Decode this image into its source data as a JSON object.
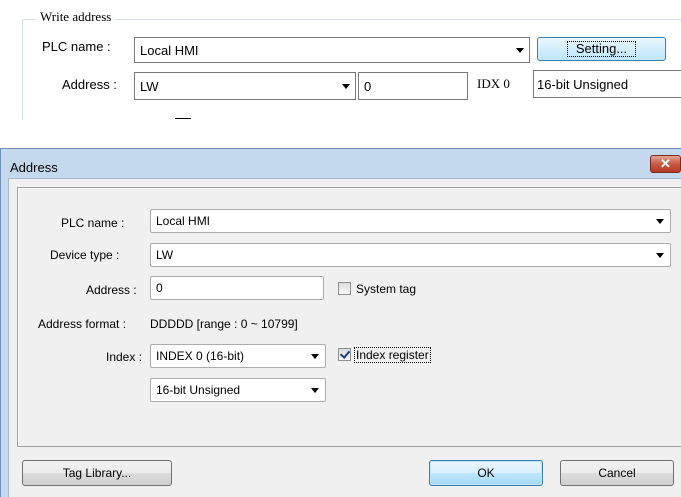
{
  "write_address": {
    "legend": "Write address",
    "plc_label": "PLC name :",
    "plc_value": "Local HMI",
    "setting_label": "Setting...",
    "address_label": "Address :",
    "device_value": "LW",
    "address_value": "0",
    "idx_label": "IDX 0",
    "data_format": "16-bit Unsigned"
  },
  "dialog": {
    "title": "Address",
    "close_glyph": "✕",
    "plc_label": "PLC name :",
    "plc_value": "Local HMI",
    "device_type_label": "Device type :",
    "device_type_value": "LW",
    "address_label": "Address :",
    "address_value": "0",
    "system_tag_label": "System tag",
    "system_tag_checked": false,
    "address_format_label": "Address format :",
    "address_format_value": "DDDDD [range : 0 ~ 10799]",
    "index_label": "Index :",
    "index_value": "INDEX 0 (16-bit)",
    "index_register_label": "Index register",
    "index_register_checked": true,
    "data_format_value": "16-bit Unsigned",
    "tag_library_label": "Tag Library...",
    "ok_label": "OK",
    "cancel_label": "Cancel"
  }
}
